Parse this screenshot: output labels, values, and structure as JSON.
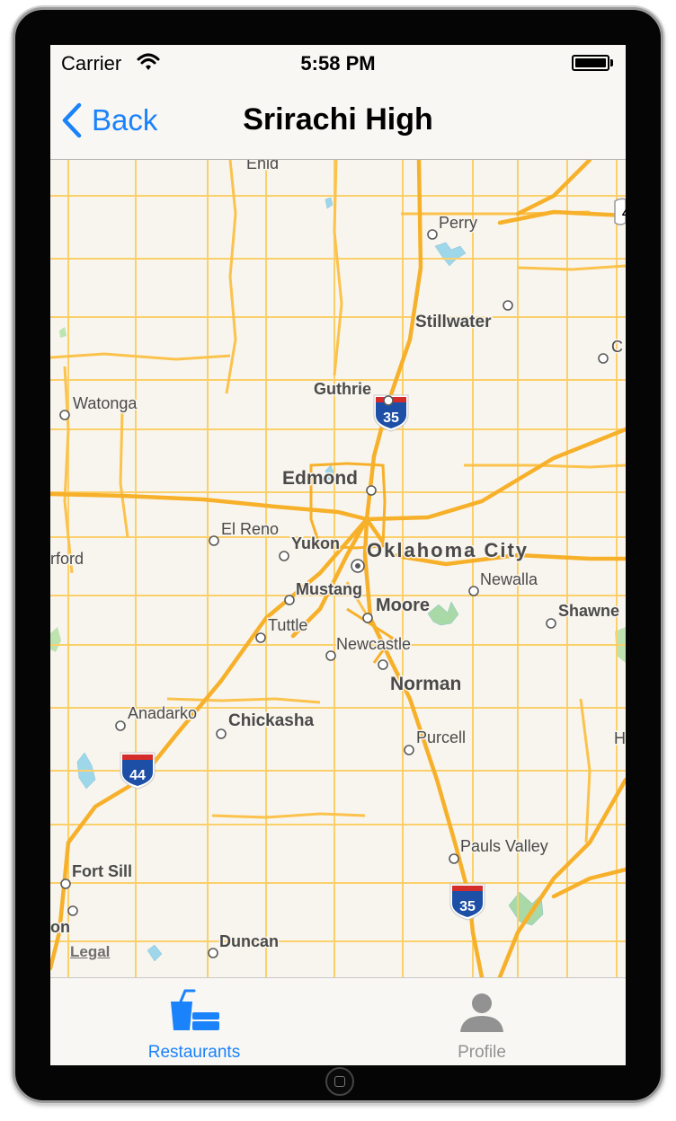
{
  "status_bar": {
    "carrier": "Carrier",
    "time": "5:58 PM"
  },
  "nav_bar": {
    "back_label": "Back",
    "title": "Srirachi High"
  },
  "map": {
    "legal": "Legal",
    "cities": [
      {
        "name": "Enid"
      },
      {
        "name": "Perry"
      },
      {
        "name": "Stillwater"
      },
      {
        "name": "Watonga"
      },
      {
        "name": "Guthrie"
      },
      {
        "name": "Edmond"
      },
      {
        "name": "El Reno"
      },
      {
        "name": "Yukon"
      },
      {
        "name": "Oklahoma City"
      },
      {
        "name": "rford"
      },
      {
        "name": "Mustang"
      },
      {
        "name": "Newalla"
      },
      {
        "name": "Moore"
      },
      {
        "name": "Shawne"
      },
      {
        "name": "Tuttle"
      },
      {
        "name": "Newcastle"
      },
      {
        "name": "Norman"
      },
      {
        "name": "Anadarko"
      },
      {
        "name": "Chickasha"
      },
      {
        "name": "Purcell"
      },
      {
        "name": "H"
      },
      {
        "name": "Pauls Valley"
      },
      {
        "name": "Fort Sill"
      },
      {
        "name": "on"
      },
      {
        "name": "Duncan"
      },
      {
        "name": "C"
      }
    ],
    "shields": [
      "35",
      "44",
      "35",
      "4"
    ],
    "colors": {
      "road": "#fbc244",
      "road_major": "#f8b637",
      "water": "#9fd7ea",
      "park": "#bde4b0"
    }
  },
  "tab_bar": {
    "accent": "#1a82fb",
    "inactive": "#929292",
    "tabs": [
      {
        "label": "Restaurants",
        "icon": "restaurants-icon",
        "selected": true
      },
      {
        "label": "Profile",
        "icon": "profile-icon",
        "selected": false
      }
    ]
  }
}
